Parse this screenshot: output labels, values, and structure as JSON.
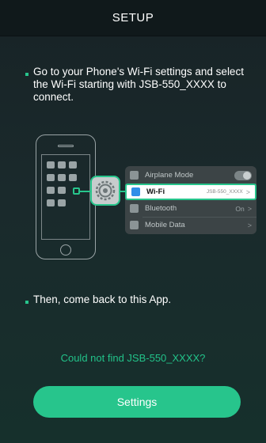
{
  "header": {
    "title": "SETUP"
  },
  "steps": [
    {
      "text": "Go to your Phone's Wi-Fi settings and select the Wi-Fi starting with JSB-550_XXXX to connect."
    },
    {
      "text": "Then, come back to this App."
    }
  ],
  "illustration": {
    "settings_rows": [
      {
        "label": "Airplane Mode",
        "value": "",
        "icon": "airplane-icon"
      },
      {
        "label": "Wi-Fi",
        "value": "JSB-550_XXXX",
        "icon": "wifi-icon"
      },
      {
        "label": "Bluetooth",
        "value": "On",
        "icon": "bluetooth-icon"
      },
      {
        "label": "Mobile Data",
        "value": "",
        "icon": "antenna-icon"
      }
    ]
  },
  "link": {
    "text": "Could not find JSB-550_XXXX?"
  },
  "button": {
    "label": "Settings"
  },
  "colors": {
    "accent": "#27c58c",
    "header_bg": "#10191b"
  }
}
